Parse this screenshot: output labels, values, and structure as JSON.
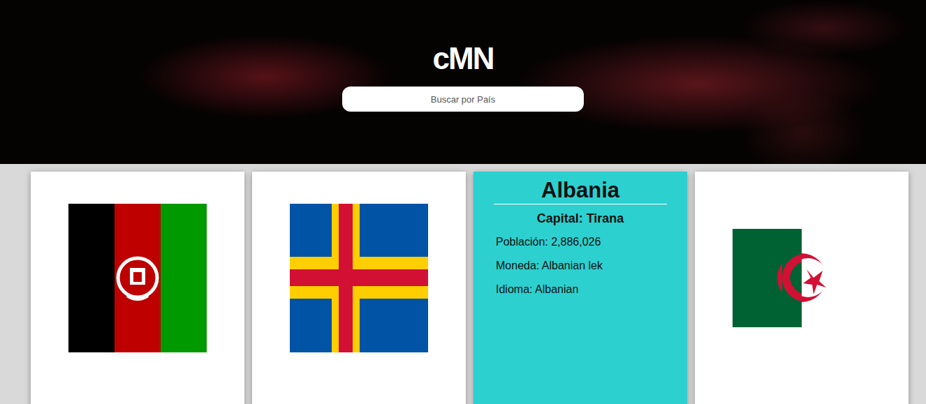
{
  "logo": {
    "text": "cMN"
  },
  "search": {
    "placeholder": "Buscar por País"
  },
  "cards": [
    {
      "flipped": false
    },
    {
      "flipped": false
    },
    {
      "flipped": true,
      "name": "Albania",
      "capital": "Capital: Tirana",
      "details": [
        "Población: 2,886,026",
        "Moneda: Albanian lek",
        "Idioma: Albanian"
      ]
    },
    {
      "flipped": false
    }
  ]
}
